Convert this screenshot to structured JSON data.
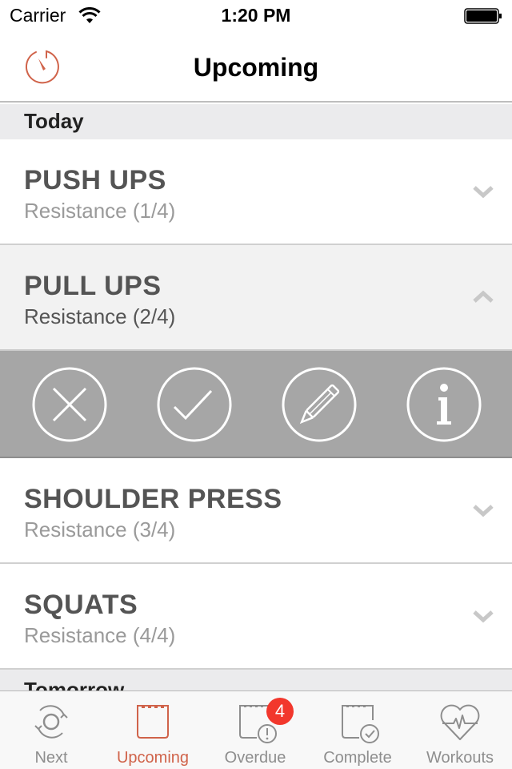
{
  "status_bar": {
    "carrier": "Carrier",
    "time": "1:20 PM",
    "wifi_icon": "wifi-icon",
    "battery_icon": "battery-full-icon"
  },
  "nav_bar": {
    "title": "Upcoming",
    "left_icon": "timer-icon"
  },
  "sections": [
    {
      "header": "Today",
      "items": [
        {
          "title": "PUSH UPS",
          "subtitle": "Resistance (1/4)",
          "expanded": false,
          "chevron": "chevron-down-icon"
        },
        {
          "title": "PULL UPS",
          "subtitle": "Resistance (2/4)",
          "expanded": true,
          "chevron": "chevron-up-icon"
        },
        {
          "title": "SHOULDER PRESS",
          "subtitle": "Resistance (3/4)",
          "expanded": false,
          "chevron": "chevron-down-icon"
        },
        {
          "title": "SQUATS",
          "subtitle": "Resistance (4/4)",
          "expanded": false,
          "chevron": "chevron-down-icon"
        }
      ]
    },
    {
      "header": "Tomorrow",
      "items": []
    }
  ],
  "action_tray": {
    "actions": [
      {
        "name": "skip",
        "icon": "close-circle-icon"
      },
      {
        "name": "complete",
        "icon": "check-circle-icon"
      },
      {
        "name": "edit",
        "icon": "pencil-circle-icon"
      },
      {
        "name": "info",
        "icon": "info-circle-icon"
      }
    ]
  },
  "tab_bar": {
    "tabs": [
      {
        "label": "Next",
        "icon": "refresh-circle-icon",
        "active": false
      },
      {
        "label": "Upcoming",
        "icon": "notepad-icon",
        "active": true
      },
      {
        "label": "Overdue",
        "icon": "notepad-alert-icon",
        "active": false,
        "badge": "4"
      },
      {
        "label": "Complete",
        "icon": "notepad-check-icon",
        "active": false
      },
      {
        "label": "Workouts",
        "icon": "heart-pulse-icon",
        "active": false
      }
    ]
  },
  "colors": {
    "accent": "#d0634a",
    "badge": "#f2372c",
    "action_tray": "#a6a6a6",
    "section_header": "#ebebed"
  }
}
